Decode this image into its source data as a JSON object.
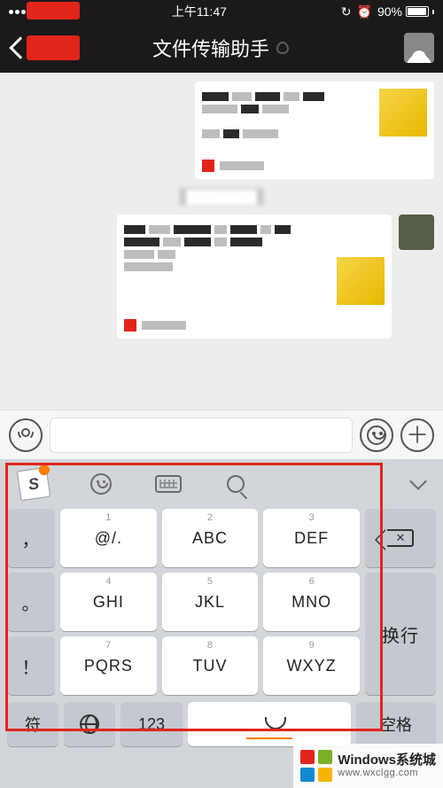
{
  "status": {
    "time": "上午11:47",
    "battery_pct": "90%",
    "lock": "⦿",
    "alarm": "⏰"
  },
  "nav": {
    "title": "文件传输助手"
  },
  "inputbar": {
    "placeholder": ""
  },
  "keyboard": {
    "side": {
      "comma": "，",
      "period": "。",
      "excl": "！"
    },
    "k1": {
      "num": "1",
      "label": "@/."
    },
    "k2": {
      "num": "2",
      "label": "ABC"
    },
    "k3": {
      "num": "3",
      "label": "DEF"
    },
    "k4": {
      "num": "4",
      "label": "GHI"
    },
    "k5": {
      "num": "5",
      "label": "JKL"
    },
    "k6": {
      "num": "6",
      "label": "MNO"
    },
    "k7": {
      "num": "7",
      "label": "PQRS"
    },
    "k8": {
      "num": "8",
      "label": "TUV"
    },
    "k9": {
      "num": "9",
      "label": "WXYZ"
    },
    "newline": "换行",
    "space": "空格"
  },
  "bottom": {
    "symbol": "符",
    "num": "123"
  },
  "watermark": {
    "line1": "Windows系统城",
    "line2": "www.wxclgg.com"
  }
}
